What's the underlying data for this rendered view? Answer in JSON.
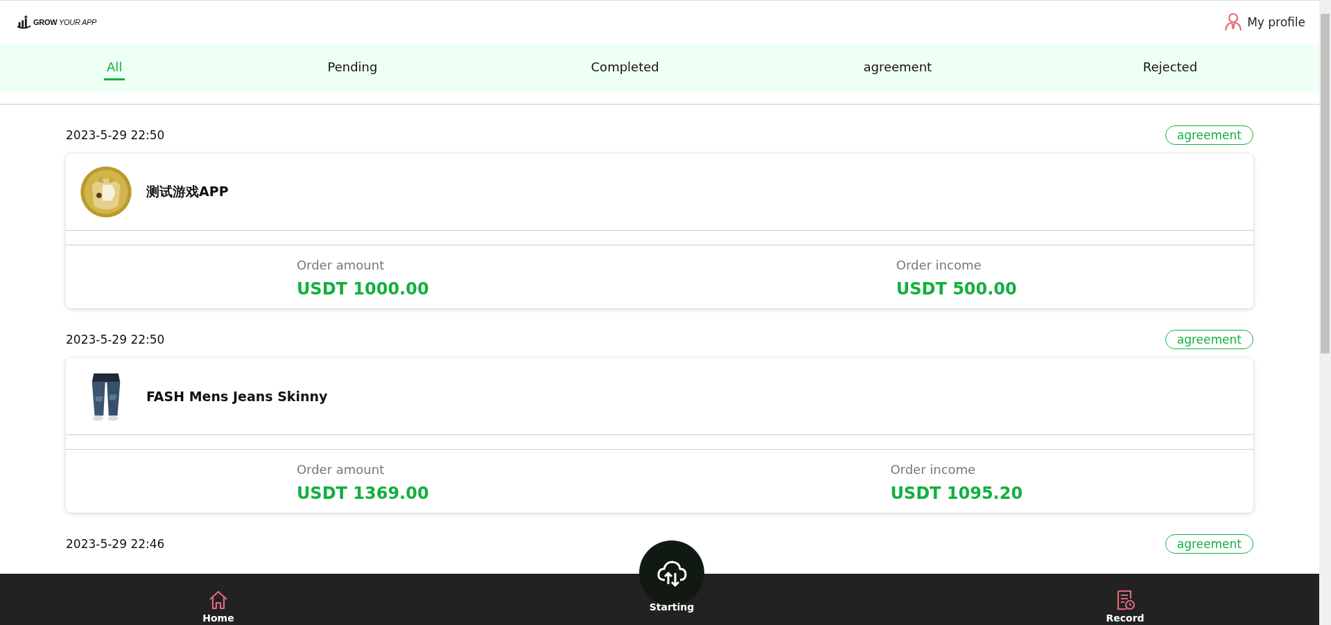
{
  "header": {
    "logo": "**GROW** *YOUR APP*",
    "profile_link": "My profile"
  },
  "tabs": [
    {
      "label": "All",
      "selected": true
    },
    {
      "label": "Pending",
      "selected": false
    },
    {
      "label": "Completed",
      "selected": false
    },
    {
      "label": "agreement",
      "selected": false
    },
    {
      "label": "Rejected",
      "selected": false
    }
  ],
  "orders": [
    {
      "time": "2023-5-29 22:50",
      "status": "agreement",
      "title": "测试游戏APP",
      "picture": {
        "kind": "coin"
      },
      "amount_label": "Order amount",
      "amount": "USDT 1000.00",
      "income_label": "Order income",
      "income": "USDT 500.00"
    },
    {
      "time": "2023-5-29 22:50",
      "status": "agreement",
      "title": "FASH Mens Jeans Skinny",
      "picture": {
        "kind": "jeans"
      },
      "amount_label": "Order amount",
      "amount": "USDT 1369.00",
      "income_label": "Order income",
      "income": "USDT 1095.20"
    },
    {
      "time": "2023-5-29 22:46",
      "status": "agreement"
    }
  ],
  "bottom_nav": [
    {
      "label": "Home",
      "kind": "home"
    },
    {
      "label": "Starting",
      "kind": "cloud"
    },
    {
      "label": "Record",
      "kind": "record"
    }
  ]
}
